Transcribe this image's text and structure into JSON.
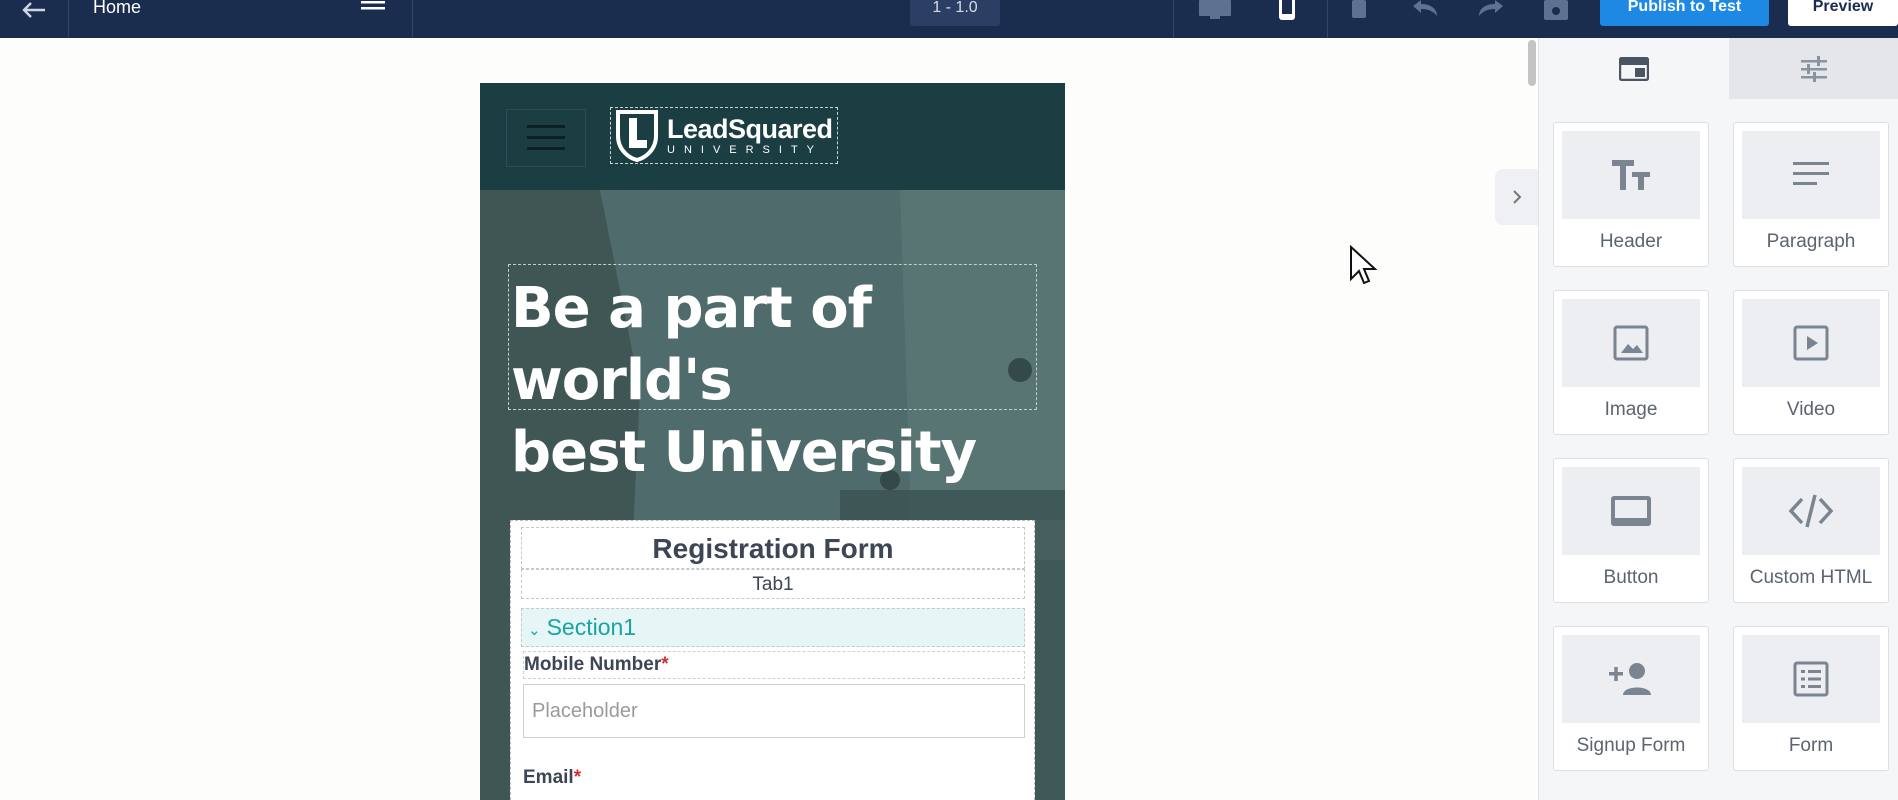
{
  "topbar": {
    "page_name": "Home",
    "zoom": "1 - 1.0",
    "publish_label": "Publish to Test",
    "preview_label": "Preview",
    "icons": [
      "back-arrow-icon",
      "menu-icon",
      "desktop-icon",
      "mobile-icon",
      "delete-icon",
      "undo-icon",
      "redo-icon",
      "save-icon"
    ]
  },
  "site": {
    "logo_main": "LeadSquared",
    "logo_sub": "UNIVERSITY",
    "hero_line1": "Be a part of world's",
    "hero_line2": "best University",
    "form": {
      "title": "Registration Form",
      "tab": "Tab1",
      "section": "Section1",
      "field1_label": "Mobile Number",
      "field1_placeholder": "Placeholder",
      "field2_label": "Email",
      "required_mark": "*"
    }
  },
  "panel": {
    "tabs": [
      "layout-icon",
      "settings-sliders-icon"
    ],
    "widgets": [
      {
        "label": "Header",
        "icon": "text-size-icon"
      },
      {
        "label": "Paragraph",
        "icon": "paragraph-icon"
      },
      {
        "label": "Image",
        "icon": "image-icon"
      },
      {
        "label": "Video",
        "icon": "video-icon"
      },
      {
        "label": "Button",
        "icon": "button-icon"
      },
      {
        "label": "Custom HTML",
        "icon": "code-icon"
      },
      {
        "label": "Signup Form",
        "icon": "add-user-icon"
      },
      {
        "label": "Form",
        "icon": "form-icon"
      }
    ]
  },
  "colors": {
    "topbar": "#1b2d4f",
    "publish": "#1e88e5",
    "site_header": "#1b3e43",
    "section_text": "#1aa3a6"
  }
}
